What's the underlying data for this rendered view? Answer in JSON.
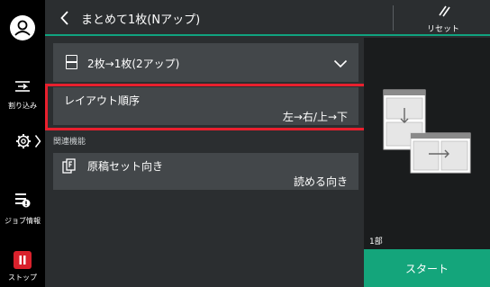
{
  "header": {
    "title": "まとめて1枚(Nアップ)",
    "reset_label": "リセット"
  },
  "sidebar": {
    "interrupt_label": "割り込み",
    "job_info_label": "ジョブ情報",
    "stop_label": "ストップ"
  },
  "settings": {
    "nup_value": "2枚→1枚(2アップ)",
    "layout_order_label": "レイアウト順序",
    "layout_order_value": "左→右/上→下",
    "related_label": "関連機能",
    "orientation_label": "原稿セット向き",
    "orientation_value": "読める向き"
  },
  "preview": {
    "copies": "1部",
    "start_label": "スタート"
  },
  "colors": {
    "accent": "#14a57b",
    "highlight": "#e8202e",
    "stop": "#d9212c"
  },
  "icons": {
    "avatar": "user-icon",
    "interrupt": "interrupt-icon",
    "settings": "gear-icon",
    "job_info": "job-info-icon",
    "stop": "stop-icon",
    "back": "chevron-left-icon",
    "reset": "reset-icon",
    "nup": "nup-layout-icon",
    "dropdown": "chevron-down-icon",
    "orientation": "document-orientation-icon"
  }
}
